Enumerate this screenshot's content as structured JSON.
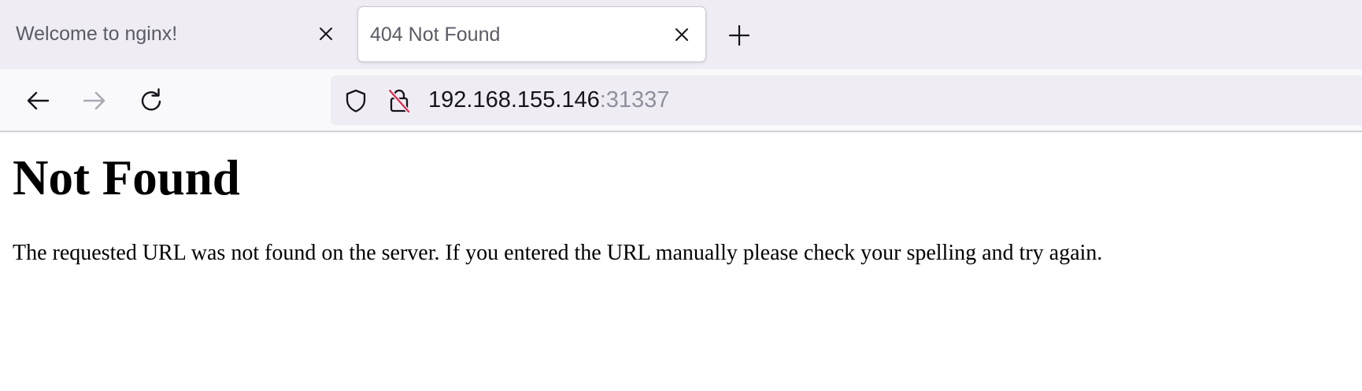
{
  "browser": {
    "tabs": [
      {
        "title": "Welcome to nginx!",
        "active": false
      },
      {
        "title": "404 Not Found",
        "active": true
      }
    ],
    "url": {
      "host": "192.168.155.146",
      "port": ":31337"
    }
  },
  "page": {
    "heading": "Not Found",
    "message": "The requested URL was not found on the server. If you entered the URL manually please check your spelling and try again."
  },
  "colors": {
    "tabstrip_bg": "#efedf3",
    "toolbar_bg": "#f9f9fb",
    "insecure_slash": "#e22850",
    "icon_color": "#15141a",
    "disabled_icon": "#a8a8b3"
  },
  "icons": [
    "close-icon",
    "plus-icon",
    "back-arrow-icon",
    "forward-arrow-icon",
    "reload-icon",
    "shield-icon",
    "insecure-lock-icon"
  ]
}
